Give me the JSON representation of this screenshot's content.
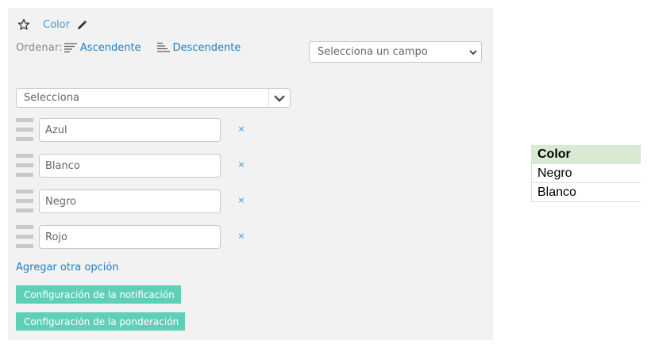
{
  "field": {
    "title": "Color"
  },
  "order": {
    "label": "Ordenar:",
    "asc_label": "Ascendente",
    "desc_label": "Descendente"
  },
  "field_select": {
    "value": "Selecciona un campo"
  },
  "main_select": {
    "value": "Selecciona"
  },
  "options": [
    {
      "value": "Azul",
      "remove": "×"
    },
    {
      "value": "Blanco",
      "remove": "×"
    },
    {
      "value": "Negro",
      "remove": "×"
    },
    {
      "value": "Rojo",
      "remove": "×"
    }
  ],
  "add_option_label": "Agregar otra opción",
  "buttons": {
    "notification": "Configuración de la notificación",
    "weighting": "Configuración de la ponderación"
  },
  "sheet": {
    "header": "Color",
    "rows": [
      "Negro",
      "Blanco"
    ]
  },
  "colors": {
    "accent_link": "#1e7fc4",
    "button_bg": "#5fcfb8",
    "sheet_header_bg": "#d9ead3",
    "panel_bg": "#f2f2f2"
  },
  "icons": {
    "title": "star-icon",
    "edit": "pencil-icon",
    "asc": "sort-asc-icon",
    "desc": "sort-desc-icon",
    "dropdown": "chevron-down-icon",
    "drag": "drag-handle-icon"
  }
}
